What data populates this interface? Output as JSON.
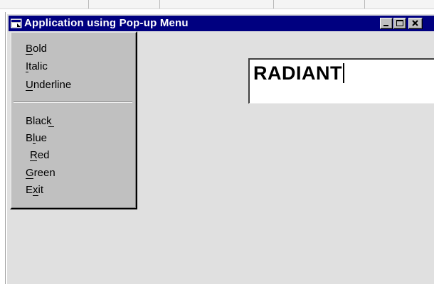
{
  "window": {
    "title": "Application using Pop-up Menu"
  },
  "popup_menu": {
    "items": [
      {
        "label": "Bold",
        "access_key": "B"
      },
      {
        "label": "Italic",
        "access_key": "I"
      },
      {
        "label": "Underline",
        "access_key": "U"
      },
      {
        "label": "Black",
        "access_key": "k"
      },
      {
        "label": "Blue",
        "access_key": "l"
      },
      {
        "label": "Red",
        "access_key": "R"
      },
      {
        "label": "Green",
        "access_key": "G"
      },
      {
        "label": "Exit",
        "access_key": "x"
      }
    ]
  },
  "textbox": {
    "value": "RADIANT"
  },
  "icons": {
    "app": "app-window-icon",
    "minimize": "minimize-icon",
    "maximize": "maximize-icon",
    "close": "close-icon"
  },
  "colors": {
    "titlebar": "#000080",
    "window_background": "#e0e0e0",
    "menu_background": "#c0c0c0"
  }
}
